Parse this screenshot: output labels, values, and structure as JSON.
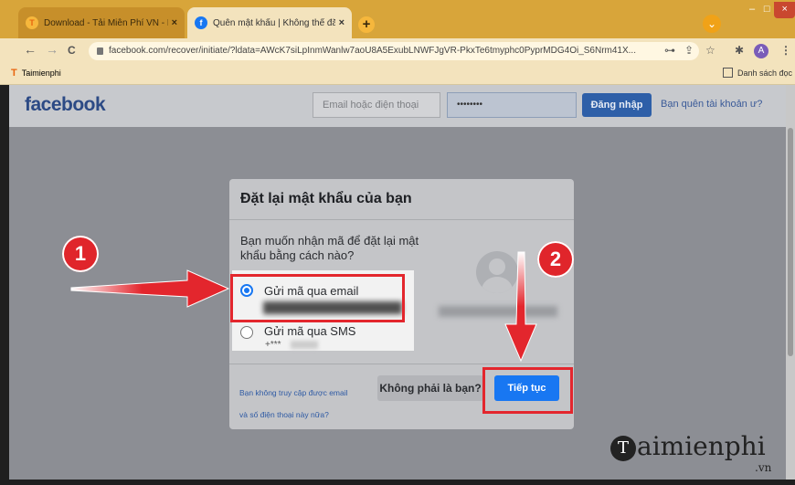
{
  "browser": {
    "tabs": [
      {
        "icon": "T",
        "label": "Download - Tải Miễn Phí VN - Ph",
        "close": "×"
      },
      {
        "icon": "f",
        "label": "Quên mật khẩu | Không thể đăng",
        "close": "×"
      }
    ],
    "new_tab": "+",
    "url": "facebook.com/recover/initiate/?ldata=AWcK7siLpInmWanlw7aoU8A5ExubLNWFJgVR-PkxTe6tmyphc0PyprMDG4Oi_S6Nrm41X...",
    "bookmark": {
      "icon": "T",
      "label": "Taimienphi"
    },
    "reading_list": "Danh sách đọc",
    "nav": {
      "back": "←",
      "forward": "→",
      "reload": "C"
    },
    "right_icons": {
      "key": "⊶",
      "share": "⇪",
      "star": "☆",
      "puzzle": "✱",
      "avatar": "A",
      "menu": "⋮"
    },
    "chevron": "⌄"
  },
  "facebook": {
    "logo": "facebook",
    "email_placeholder": "Email hoặc điện thoại",
    "password_value": "••••••••",
    "login_label": "Đăng nhập",
    "forgot_label": "Bạn quên tài khoản ư?"
  },
  "dialog": {
    "title": "Đặt lại mật khẩu của bạn",
    "question": "Bạn muốn nhận mã để đặt lại mật khẩu bằng cách nào?",
    "option_email": "Gửi mã qua email",
    "option_sms": "Gửi mã qua SMS",
    "option_sms_masked": "+***",
    "no_access_line1": "Bạn không truy cập được email",
    "no_access_line2": "và số điện thoại này nữa?",
    "not_you_label": "Không phải là bạn?",
    "continue_label": "Tiếp tục",
    "selected_option": "email"
  },
  "annotations": {
    "step1": "1",
    "step2": "2",
    "highlight_color": "#e3262d"
  },
  "watermark": {
    "logo_letter": "T",
    "text": "aimienphi",
    "suffix": ".vn"
  }
}
